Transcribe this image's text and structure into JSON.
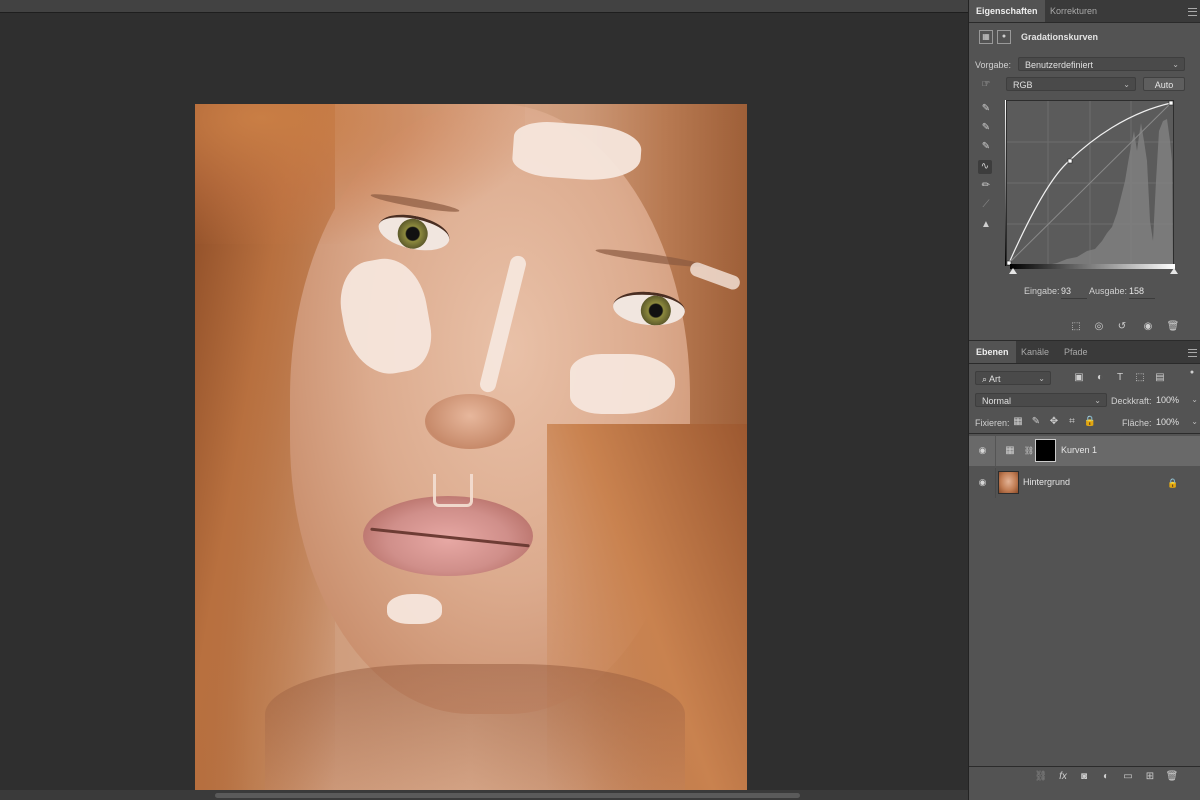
{
  "properties_panel": {
    "tabs": [
      {
        "label": "Eigenschaften",
        "active": true
      },
      {
        "label": "Korrekturen",
        "active": false
      }
    ],
    "adjustment_title": "Gradationskurven",
    "preset_label": "Vorgabe:",
    "preset_value": "Benutzerdefiniert",
    "channel_value": "RGB",
    "auto_button": "Auto",
    "input_label": "Eingabe:",
    "input_value": "93",
    "output_label": "Ausgabe:",
    "output_value": "158",
    "curve_icons": [
      "eyedropper-black-icon",
      "eyedropper-gray-icon",
      "eyedropper-white-icon",
      "curve-point-icon",
      "pencil-icon",
      "smooth-icon",
      "histogram-warning-icon"
    ]
  },
  "layers_panel": {
    "tabs": [
      {
        "label": "Ebenen",
        "active": true
      },
      {
        "label": "Kanäle",
        "active": false
      },
      {
        "label": "Pfade",
        "active": false
      }
    ],
    "filter_value": "Art",
    "blend_mode": "Normal",
    "opacity_label": "Deckkraft:",
    "opacity_value": "100%",
    "lock_label": "Fixieren:",
    "fill_label": "Fläche:",
    "fill_value": "100%",
    "layers": [
      {
        "name": "Kurven 1",
        "selected": true
      },
      {
        "name": "Hintergrund",
        "selected": false,
        "locked": true
      }
    ]
  },
  "colors": {
    "panel_bg": "#535353",
    "canvas_bg": "#2f2f2f",
    "selected_layer": "#696969"
  }
}
